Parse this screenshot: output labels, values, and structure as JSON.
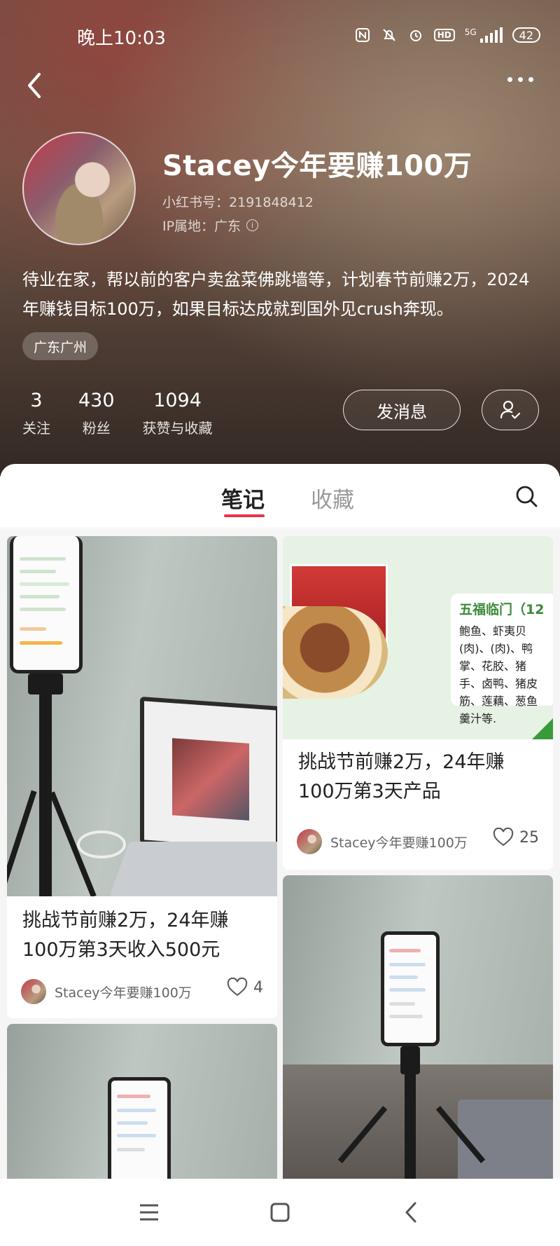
{
  "status_bar": {
    "time": "晚上10:03",
    "battery": "42",
    "network": "5G"
  },
  "profile": {
    "username": "Stacey今年要赚100万",
    "user_id": "小红书号：2191848412",
    "ip_location": "IP属地：广东",
    "bio": "待业在家，帮以前的客户卖盆菜佛跳墙等，计划春节前赚2万，2024年赚钱目标100万，如果目标达成就到国外见crush奔现。",
    "location_tag": "广东广州",
    "stats": [
      {
        "num": "3",
        "label": "关注"
      },
      {
        "num": "430",
        "label": "粉丝"
      },
      {
        "num": "1094",
        "label": "获赞与收藏"
      }
    ],
    "message_button": "发消息"
  },
  "tabs": {
    "notes": "笔记",
    "collections": "收藏"
  },
  "feed": {
    "cards": [
      {
        "title": "挑战节前赚2万，24年赚100万第3天收入500元",
        "author": "Stacey今年要赚100万",
        "likes": "4"
      },
      {
        "title": "挑战节前赚2万，24年赚100万第3天产品",
        "author": "Stacey今年要赚100万",
        "likes": "25",
        "panel_title": "五福临门（12",
        "panel_text": "鲍鱼、虾夷贝(肉)、(肉)、鸭掌、花胶、猪手、卤鸭、猪皮筋、莲藕、葱鱼羹汁等."
      }
    ]
  },
  "colors": {
    "accent": "#e8344b",
    "header_bg": "#6f5648"
  }
}
